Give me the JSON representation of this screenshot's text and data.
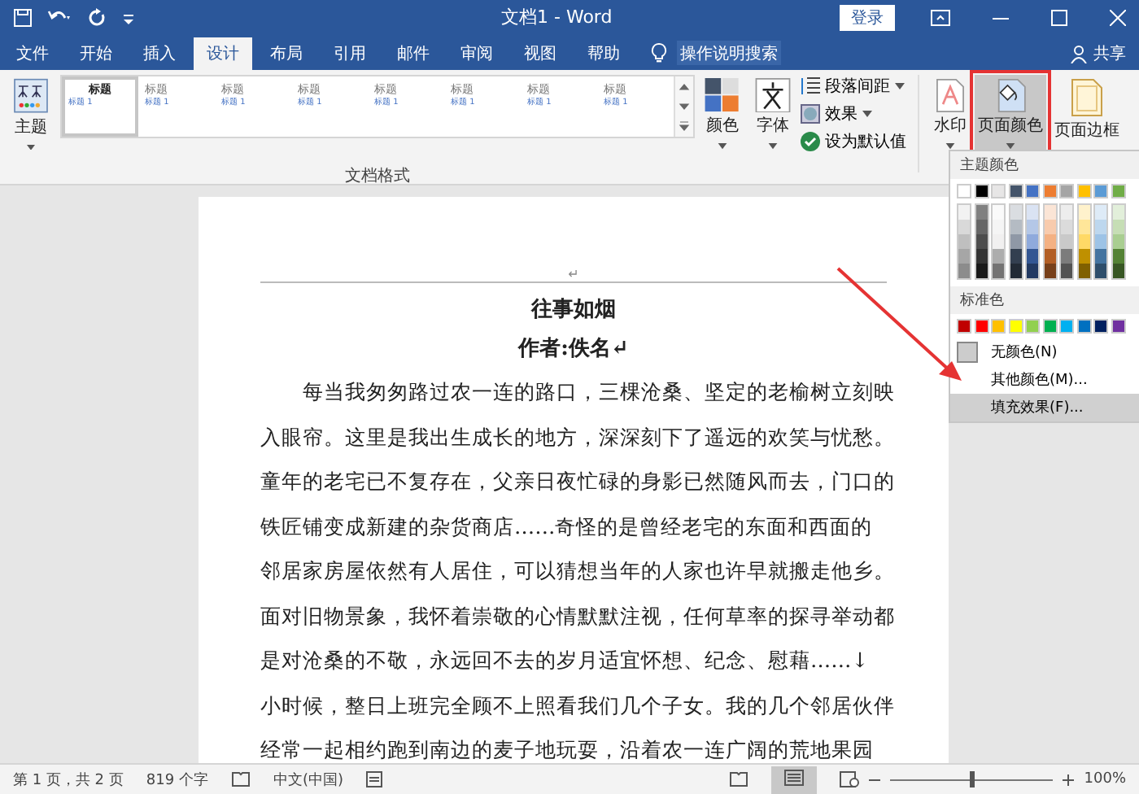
{
  "window": {
    "title": "文档1  -  Word",
    "login": "登录"
  },
  "tabs": [
    {
      "label": "文件",
      "selected": false
    },
    {
      "label": "开始",
      "selected": false
    },
    {
      "label": "插入",
      "selected": false
    },
    {
      "label": "设计",
      "selected": true
    },
    {
      "label": "布局",
      "selected": false
    },
    {
      "label": "引用",
      "selected": false
    },
    {
      "label": "邮件",
      "selected": false
    },
    {
      "label": "审阅",
      "selected": false
    },
    {
      "label": "视图",
      "selected": false
    },
    {
      "label": "帮助",
      "selected": false
    }
  ],
  "tell_me": "操作说明搜索",
  "share": "共享",
  "ribbon": {
    "theme": "主题",
    "gallery": [
      {
        "heading": "标题",
        "sub": "标题 1",
        "selected": true
      },
      {
        "heading": "标题",
        "sub": "标题 1",
        "selected": false
      },
      {
        "heading": "标题",
        "sub": "标题 1",
        "selected": false
      },
      {
        "heading": "标题",
        "sub": "标题 1",
        "selected": false
      },
      {
        "heading": "标题",
        "sub": "标题 1",
        "selected": false
      },
      {
        "heading": "标题",
        "sub": "标题 1",
        "selected": false
      },
      {
        "heading": "标题",
        "sub": "标题 1",
        "selected": false
      },
      {
        "heading": "标题",
        "sub": "标题 1",
        "selected": false
      }
    ],
    "group_label": "文档格式",
    "colors": "颜色",
    "fonts": "字体",
    "spacing": "段落间距",
    "effects": "效果",
    "set_default": "设为默认值",
    "watermark": "水印",
    "page_color": "页面颜色",
    "page_border": "页面边框"
  },
  "document": {
    "header_mark": "↵",
    "title": "往事如烟",
    "author": "作者:佚名↵",
    "lines": [
      "每当我匆匆路过农一连的路口，三棵沧桑、坚定的老榆树立刻映",
      "入眼帘。这里是我出生成长的地方，深深刻下了遥远的欢笑与忧愁。",
      "童年的老宅已不复存在，父亲日夜忙碌的身影已然随风而去，门口的",
      "铁匠铺变成新建的杂货商店……奇怪的是曾经老宅的东面和西面的",
      "邻居家房屋依然有人居住，可以猜想当年的人家也许早就搬走他乡。",
      "面对旧物景象，我怀着崇敬的心情默默注视，任何草率的探寻举动都",
      "是对沧桑的不敬，永远回不去的岁月适宜怀想、纪念、慰藉……↓",
      "小时候，整日上班完全顾不上照看我们几个子女。我的几个邻居伙伴",
      "经常一起相约跑到南边的麦子地玩耍，沿着农一连广阔的荒地果园"
    ]
  },
  "color_menu": {
    "theme_label": "主题颜色",
    "theme_colors": [
      {
        "color": "#ffffff"
      },
      {
        "color": "#000000"
      },
      {
        "color": "#e7e6e6"
      },
      {
        "color": "#44546a"
      },
      {
        "color": "#4472c4"
      },
      {
        "color": "#ed7d31"
      },
      {
        "color": "#a5a5a5"
      },
      {
        "color": "#ffc000"
      },
      {
        "color": "#5b9bd5"
      },
      {
        "color": "#70ad47"
      }
    ],
    "standard_label": "标准色",
    "standard_colors": [
      {
        "color": "#c00000"
      },
      {
        "color": "#ff0000"
      },
      {
        "color": "#ffc000"
      },
      {
        "color": "#ffff00"
      },
      {
        "color": "#92d050"
      },
      {
        "color": "#00b050"
      },
      {
        "color": "#00b0f0"
      },
      {
        "color": "#0070c0"
      },
      {
        "color": "#002060"
      },
      {
        "color": "#7030a0"
      }
    ],
    "items": [
      {
        "label": "无颜色(N)",
        "kind": "swatch",
        "selected": false
      },
      {
        "label": "其他颜色(M)...",
        "kind": "plain",
        "selected": false
      },
      {
        "label": "填充效果(F)...",
        "kind": "plain",
        "selected": true
      }
    ]
  },
  "status_bar": {
    "page": "第 1 页，共 2 页",
    "words": "819 个字",
    "language": "中文(中国)",
    "zoom": "100%",
    "level": 0.5
  }
}
